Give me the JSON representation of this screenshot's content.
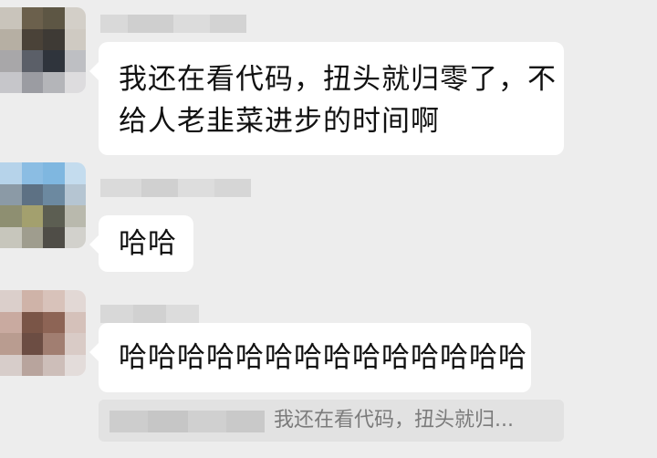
{
  "messages": [
    {
      "lines": [
        "我还在看代码，扭头就归零了，不",
        "给人老韭菜进步的时间啊"
      ]
    },
    {
      "lines": [
        "哈哈"
      ]
    },
    {
      "lines": [
        "哈哈哈哈哈哈哈哈哈哈哈哈哈哈"
      ]
    }
  ],
  "quote": {
    "text": "我还在看代码，扭头就归..."
  },
  "colors": {
    "background": "#ededed",
    "bubble": "#ffffff",
    "quote_bg": "#e2e2e2",
    "quote_text": "#7b7b7b"
  }
}
